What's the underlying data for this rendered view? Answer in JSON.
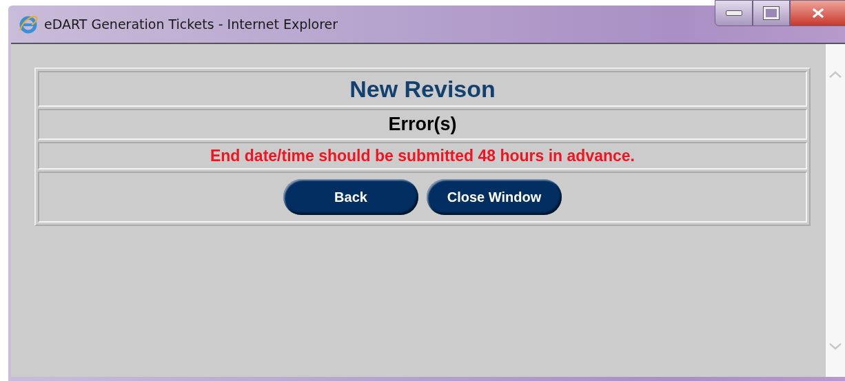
{
  "window": {
    "title": "eDART Generation Tickets - Internet Explorer"
  },
  "heading": "New Revison",
  "subheading": "Error(s)",
  "error_message": "End date/time should be submitted 48 hours in advance.",
  "buttons": [
    "Back",
    "Close Window"
  ]
}
